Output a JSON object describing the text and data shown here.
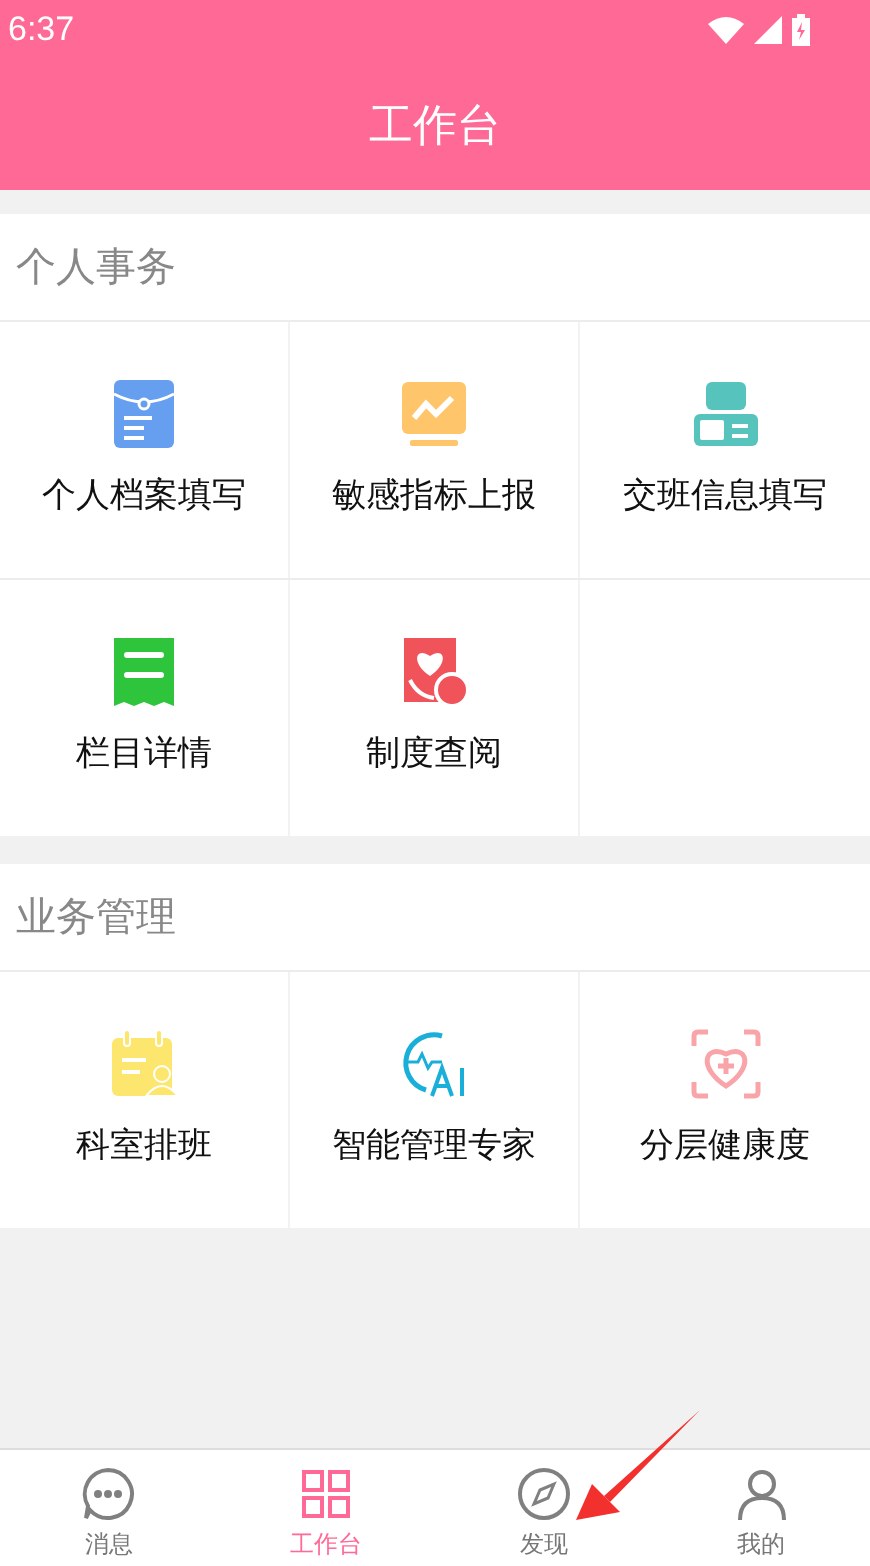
{
  "status_bar": {
    "time": "6:37"
  },
  "header": {
    "title": "工作台"
  },
  "sections": [
    {
      "title": "个人事务",
      "items": [
        {
          "label": "个人档案填写",
          "kind": "folder"
        },
        {
          "label": "敏感指标上报",
          "kind": "monitor"
        },
        {
          "label": "交班信息填写",
          "kind": "handover"
        },
        {
          "label": "栏目详情",
          "kind": "receipt"
        },
        {
          "label": "制度查阅",
          "kind": "care"
        }
      ]
    },
    {
      "title": "业务管理",
      "items": [
        {
          "label": "科室排班",
          "kind": "calendar"
        },
        {
          "label": "智能管理专家",
          "kind": "ai"
        },
        {
          "label": "分层健康度",
          "kind": "heart"
        }
      ]
    }
  ],
  "tab_bar": [
    {
      "label": "消息",
      "kind": "chat",
      "selected": false
    },
    {
      "label": "工作台",
      "kind": "grid",
      "selected": true
    },
    {
      "label": "发现",
      "kind": "compass",
      "selected": false
    },
    {
      "label": "我的",
      "kind": "person",
      "selected": false
    }
  ],
  "annotation": {
    "kind": "arrow"
  }
}
